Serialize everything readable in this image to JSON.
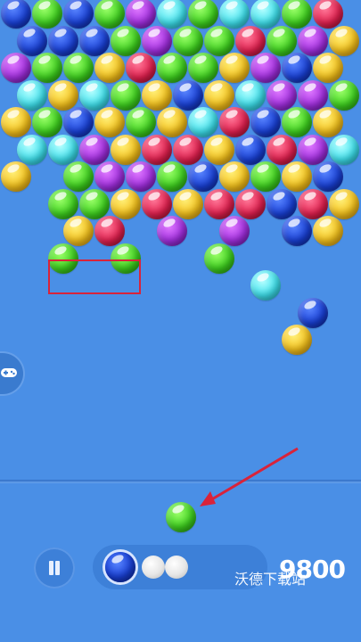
{
  "score": "9800",
  "watermark": "沃德下载站",
  "shooter": {
    "color": "green"
  },
  "next_queue": [
    "blue",
    "empty",
    "empty"
  ],
  "colors": {
    "background": "#4a8fe6",
    "highlight_box": "#d9233a",
    "arrow": "#d9233a"
  },
  "icons": {
    "pause": "pause-icon",
    "side_tab": "gamepad-icon"
  },
  "grid": {
    "rows": [
      {
        "offset": false,
        "cells": [
          "blue",
          "green",
          "blue",
          "green",
          "purple",
          "cyan",
          "green",
          "cyan",
          "cyan",
          "green",
          "red"
        ]
      },
      {
        "offset": true,
        "cells": [
          "blue",
          "blue",
          "blue",
          "green",
          "purple",
          "green",
          "green",
          "red",
          "green",
          "purple",
          "yellow"
        ]
      },
      {
        "offset": false,
        "cells": [
          "purple",
          "green",
          "green",
          "yellow",
          "red",
          "green",
          "green",
          "yellow",
          "purple",
          "blue",
          "yellow"
        ]
      },
      {
        "offset": true,
        "cells": [
          "cyan",
          "yellow",
          "cyan",
          "green",
          "yellow",
          "blue",
          "yellow",
          "cyan",
          "purple",
          "purple",
          "green"
        ]
      },
      {
        "offset": false,
        "cells": [
          "yellow",
          "green",
          "blue",
          "yellow",
          "green",
          "yellow",
          "cyan",
          "red",
          "blue",
          "green",
          "yellow"
        ]
      },
      {
        "offset": true,
        "cells": [
          "cyan",
          "cyan",
          "purple",
          "yellow",
          "red",
          "red",
          "yellow",
          "blue",
          "red",
          "purple",
          "cyan"
        ]
      },
      {
        "offset": false,
        "cells": [
          "yellow",
          "",
          "green",
          "purple",
          "purple",
          "green",
          "blue",
          "yellow",
          "green",
          "yellow",
          "blue"
        ]
      },
      {
        "offset": true,
        "cells": [
          "",
          "green",
          "green",
          "yellow",
          "red",
          "yellow",
          "red",
          "red",
          "blue",
          "red",
          "yellow"
        ]
      },
      {
        "offset": false,
        "cells": [
          "",
          "",
          "yellow",
          "red",
          "",
          "purple",
          "",
          "purple",
          "",
          "blue",
          "yellow"
        ]
      },
      {
        "offset": true,
        "cells": [
          "",
          "green",
          "",
          "green",
          "",
          "",
          "green",
          "",
          "",
          "",
          ""
        ]
      },
      {
        "offset": false,
        "cells": [
          "",
          "",
          "",
          "",
          "",
          "",
          "",
          "",
          "cyan",
          "",
          ""
        ]
      },
      {
        "offset": true,
        "cells": [
          "",
          "",
          "",
          "",
          "",
          "",
          "",
          "",
          "",
          "blue",
          ""
        ]
      },
      {
        "offset": false,
        "cells": [
          "",
          "",
          "",
          "",
          "",
          "",
          "",
          "",
          "",
          "yellow",
          ""
        ]
      }
    ]
  }
}
